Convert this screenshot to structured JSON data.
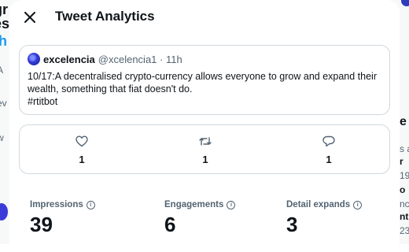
{
  "modal": {
    "title": "Tweet Analytics",
    "close_icon": "close-icon"
  },
  "tweet": {
    "author": "excelencia",
    "handle": "@xcelencia1 · 11h",
    "text_line1": "10/17:A decentralised crypto-currency allows everyone to grow and expand their",
    "text_line2": "wealth, something that fiat doesn't do.",
    "text_line3": "#rtitbot"
  },
  "actions": {
    "likes": "1",
    "retweets": "1",
    "replies": "1"
  },
  "metrics": {
    "impressions_label": "Impressions",
    "impressions_value": "39",
    "engagements_label": "Engagements",
    "engagements_value": "6",
    "detail_label": "Detail expands",
    "detail_value": "3"
  }
}
